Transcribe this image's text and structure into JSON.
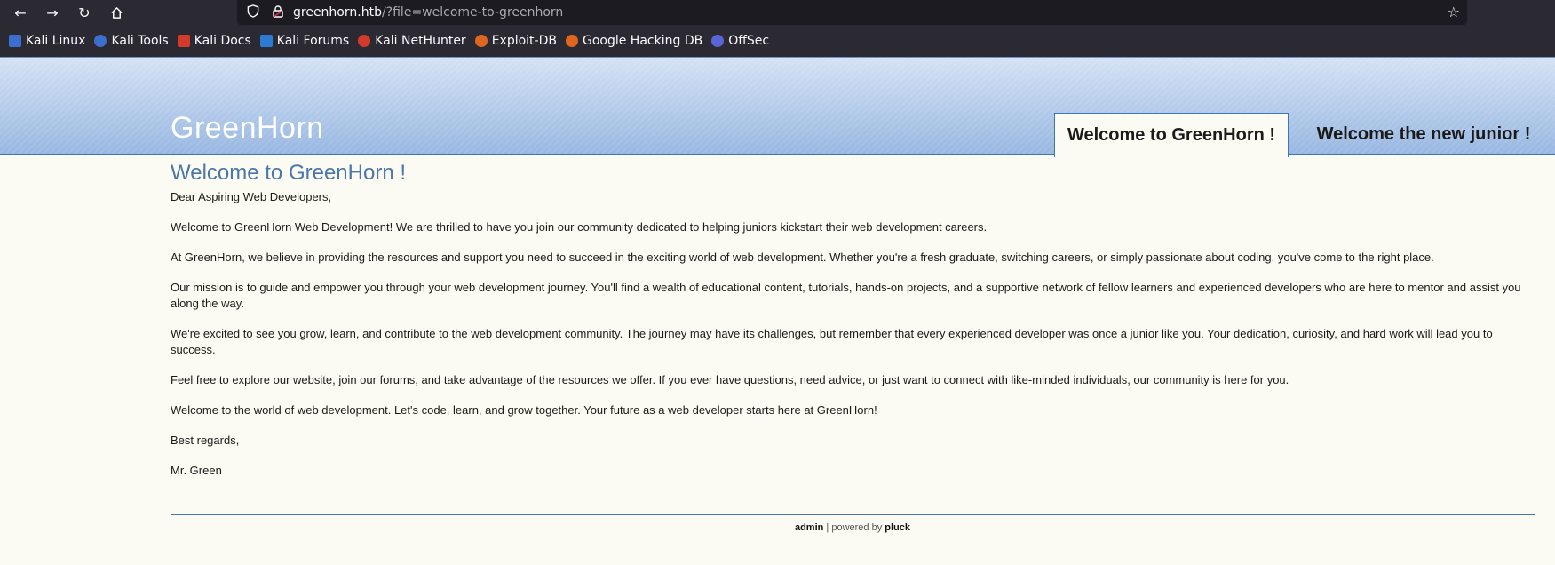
{
  "browser": {
    "url_host": "greenhorn.htb",
    "url_path": "/?file=welcome-to-greenhorn",
    "icons": [
      "back-arrow-icon",
      "forward-arrow-icon",
      "reload-icon",
      "home-icon",
      "shield-icon",
      "lock-icon",
      "star-icon"
    ],
    "bookmarks": [
      {
        "label": "Kali Linux",
        "color": "#3b6fcf"
      },
      {
        "label": "Kali Tools",
        "color": "#3b6fcf"
      },
      {
        "label": "Kali Docs",
        "color": "#d23a2c"
      },
      {
        "label": "Kali Forums",
        "color": "#2c7bd2"
      },
      {
        "label": "Kali NetHunter",
        "color": "#d23a2c"
      },
      {
        "label": "Exploit-DB",
        "color": "#e0651e"
      },
      {
        "label": "Google Hacking DB",
        "color": "#e0651e"
      },
      {
        "label": "OffSec",
        "color": "#5a63d8"
      }
    ]
  },
  "site": {
    "title": "GreenHorn",
    "tabs": [
      {
        "label": "Welcome to GreenHorn !"
      },
      {
        "label": "Welcome the new junior !"
      }
    ]
  },
  "content": {
    "title": "Welcome to GreenHorn !",
    "paragraphs": [
      "Dear Aspiring Web Developers,",
      "Welcome to GreenHorn Web Development! We are thrilled to have you join our community dedicated to helping juniors kickstart their web development careers.",
      "At GreenHorn, we believe in providing the resources and support you need to succeed in the exciting world of web development. Whether you're a fresh graduate, switching careers, or simply passionate about coding, you've come to the right place.",
      "Our mission is to guide and empower you through your web development journey. You'll find a wealth of educational content, tutorials, hands-on projects, and a supportive network of fellow learners and experienced developers who are here to mentor and assist you along the way.",
      "We're excited to see you grow, learn, and contribute to the web development community. The journey may have its challenges, but remember that every experienced developer was once a junior like you. Your dedication, curiosity, and hard work will lead you to success.",
      "Feel free to explore our website, join our forums, and take advantage of the resources we offer. If you ever have questions, need advice, or just want to connect with like-minded individuals, our community is here for you.",
      "Welcome to the world of web development. Let's code, learn, and grow together. Your future as a web developer starts here at GreenHorn!",
      "Best regards,",
      "Mr. Green"
    ]
  },
  "footer": {
    "admin": "admin",
    "separator": " | powered by ",
    "pluck": "pluck"
  }
}
